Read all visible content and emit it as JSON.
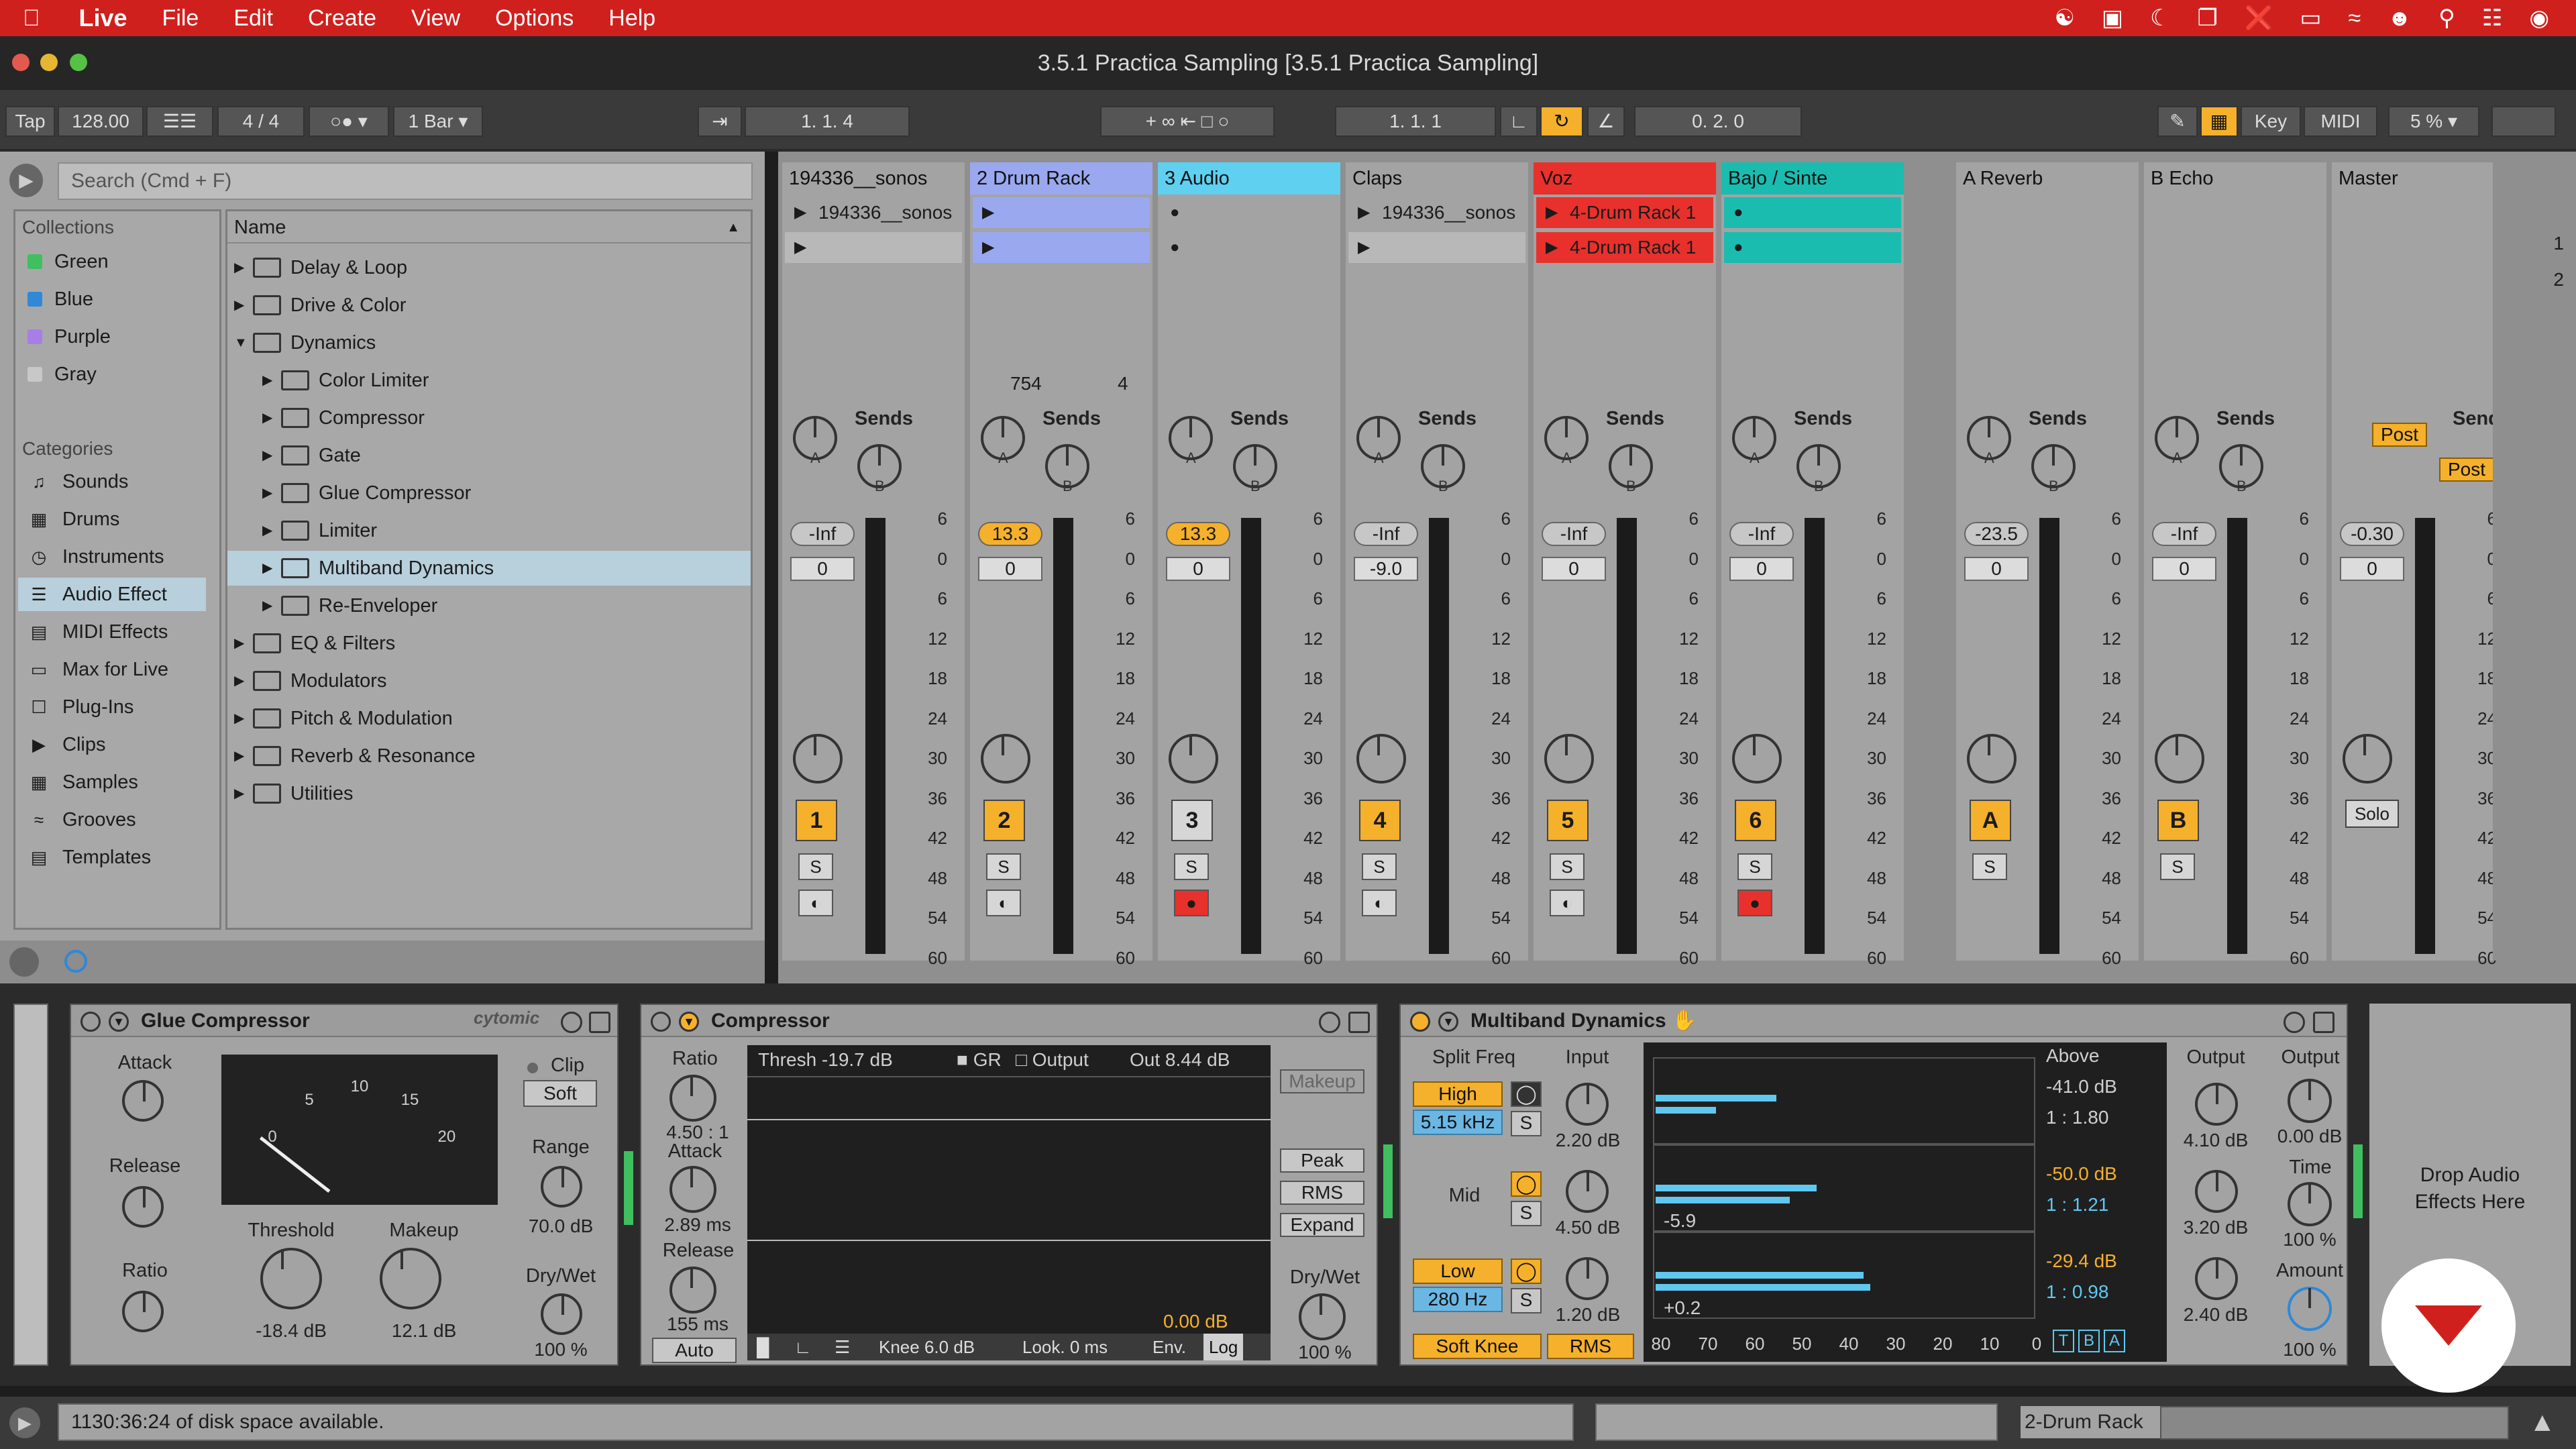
{
  "menubar": {
    "app": "Live",
    "items": [
      "File",
      "Edit",
      "Create",
      "View",
      "Options",
      "Help"
    ]
  },
  "window": {
    "title": "3.5.1 Practica Sampling  [3.5.1 Practica Sampling]"
  },
  "transport": {
    "tap": "Tap",
    "tempo": "128.00",
    "signature": "4 / 4",
    "quantize": "1 Bar",
    "position": "1.   1.   4",
    "loop_start": "1.   1.   1",
    "loop_length": "0.   2.   0",
    "key": "Key",
    "midi": "MIDI",
    "cpu": "5 %"
  },
  "browser": {
    "search_placeholder": "Search (Cmd + F)",
    "collections_title": "Collections",
    "collections": [
      {
        "name": "Green",
        "color": "#3fbf5f"
      },
      {
        "name": "Blue",
        "color": "#2f88d8"
      },
      {
        "name": "Purple",
        "color": "#a77ee6"
      },
      {
        "name": "Gray",
        "color": "#c8c8c8"
      }
    ],
    "categories_title": "Categories",
    "categories": [
      "Sounds",
      "Drums",
      "Instruments",
      "Audio Effect",
      "MIDI Effects",
      "Max for Live",
      "Plug-Ins",
      "Clips",
      "Samples",
      "Grooves",
      "Templates"
    ],
    "selected_category": "Audio Effect",
    "name_header": "Name",
    "items": [
      {
        "name": "Delay & Loop",
        "indent": 0,
        "open": false
      },
      {
        "name": "Drive & Color",
        "indent": 0,
        "open": false
      },
      {
        "name": "Dynamics",
        "indent": 0,
        "open": true
      },
      {
        "name": "Color Limiter",
        "indent": 1,
        "open": false
      },
      {
        "name": "Compressor",
        "indent": 1,
        "open": false
      },
      {
        "name": "Gate",
        "indent": 1,
        "open": false
      },
      {
        "name": "Glue Compressor",
        "indent": 1,
        "open": false
      },
      {
        "name": "Limiter",
        "indent": 1,
        "open": false
      },
      {
        "name": "Multiband Dynamics",
        "indent": 1,
        "open": false,
        "selected": true
      },
      {
        "name": "Re-Enveloper",
        "indent": 1,
        "open": false
      },
      {
        "name": "EQ & Filters",
        "indent": 0,
        "open": false
      },
      {
        "name": "Modulators",
        "indent": 0,
        "open": false
      },
      {
        "name": "Pitch & Modulation",
        "indent": 0,
        "open": false
      },
      {
        "name": "Reverb & Resonance",
        "indent": 0,
        "open": false
      },
      {
        "name": "Utilities",
        "indent": 0,
        "open": false
      }
    ]
  },
  "tracks": [
    {
      "name": "194336__sonos",
      "color": "#a3a3a3",
      "clip1": "194336__sonos",
      "clipcolor": "#a3a3a3",
      "vol": "-Inf",
      "volOn": false,
      "pan": "0",
      "num": "1",
      "numOn": true,
      "rec": false
    },
    {
      "name": "2 Drum Rack",
      "color": "#9aa8f0",
      "clip1": "",
      "clipcolor": "#9aa8f0",
      "vol": "13.3",
      "volOn": true,
      "pan": "0",
      "num": "2",
      "numOn": true,
      "rec": false,
      "extra": "754",
      "extra2": "4"
    },
    {
      "name": "3 Audio",
      "color": "#5fd0f0",
      "clip1": "",
      "clipcolor": "#a3a3a3",
      "vol": "13.3",
      "volOn": true,
      "pan": "0",
      "num": "3",
      "numOn": false,
      "rec": true
    },
    {
      "name": "Claps",
      "color": "#a3a3a3",
      "clip1": "194336__sonos",
      "clipcolor": "#a3a3a3",
      "vol": "-Inf",
      "volOn": false,
      "pan": "-9.0",
      "num": "4",
      "numOn": true,
      "rec": false
    },
    {
      "name": "Voz",
      "color": "#e8312c",
      "clip1": "4-Drum Rack 1",
      "clip2": "4-Drum Rack 1",
      "clipcolor": "#e8312c",
      "vol": "-Inf",
      "volOn": false,
      "pan": "0",
      "num": "5",
      "numOn": true,
      "rec": false
    },
    {
      "name": "Bajo / Sinte",
      "color": "#1bbcb0",
      "clip1": "",
      "clipcolor": "#1bbcb0",
      "vol": "-Inf",
      "volOn": false,
      "pan": "0",
      "num": "6",
      "numOn": true,
      "rec": true
    }
  ],
  "returns": [
    {
      "name": "A Reverb",
      "vol": "-23.5",
      "pan": "0",
      "num": "A"
    },
    {
      "name": "B Echo",
      "vol": "-Inf",
      "pan": "0",
      "num": "B"
    },
    {
      "name": "Master",
      "vol": "-0.30",
      "pan": "0",
      "num": "Solo",
      "post": "Post"
    }
  ],
  "mixer": {
    "sends": "Sends",
    "scale": [
      "6",
      "0",
      "6",
      "12",
      "18",
      "24",
      "30",
      "36",
      "42",
      "48",
      "54",
      "60"
    ],
    "solo": "S",
    "scene1": "1",
    "scene2": "2"
  },
  "glue": {
    "title": "Glue Compressor",
    "brand": "cytomic",
    "attack": "Attack",
    "release": "Release",
    "ratio": "Ratio",
    "clip": "Clip",
    "soft": "Soft",
    "range": "Range",
    "range_val": "70.0 dB",
    "threshold": "Threshold",
    "threshold_val": "-18.4 dB",
    "makeup": "Makeup",
    "makeup_val": "12.1 dB",
    "drywet": "Dry/Wet",
    "drywet_val": "100 %",
    "meter_ticks": [
      "0",
      "5",
      "10",
      "15",
      "20"
    ]
  },
  "comp": {
    "title": "Compressor",
    "ratio": "Ratio",
    "ratio_val": "4.50 : 1",
    "attack": "Attack",
    "attack_val": "2.89 ms",
    "release": "Release",
    "release_val": "155 ms",
    "auto": "Auto",
    "thresh": "Thresh -19.7 dB",
    "gr": "GR",
    "output": "Output",
    "out": "Out 8.44 dB",
    "out_db": "0.00 dB",
    "makeup": "Makeup",
    "peak": "Peak",
    "rms": "RMS",
    "expand": "Expand",
    "knee": "Knee 6.0 dB",
    "look": "Look. 0 ms",
    "env": "Env.",
    "log": "Log",
    "drywet": "Dry/Wet",
    "drywet_val": "100 %"
  },
  "mbd": {
    "title": "Multiband Dynamics",
    "split": "Split Freq",
    "input": "Input",
    "high": "High",
    "high_freq": "5.15 kHz",
    "mid": "Mid",
    "low": "Low",
    "low_freq": "280 Hz",
    "in_h": "2.20 dB",
    "in_m": "4.50 dB",
    "in_l": "1.20 dB",
    "above": "Above",
    "a_h": "-41.0 dB",
    "r_h": "1 : 1.80",
    "a_m": "-50.0 dB",
    "r_m": "1 : 1.21",
    "a_l": "-29.4 dB",
    "r_l": "1 : 0.98",
    "mval": "-5.9",
    "lval": "+0.2",
    "output": "Output",
    "o_h": "4.10 dB",
    "o_m": "3.20 dB",
    "o_l": "2.40 dB",
    "output2": "Output",
    "o2": "0.00 dB",
    "time": "Time",
    "time_val": "100 %",
    "amount": "Amount",
    "amount_val": "100 %",
    "soft_knee": "Soft Knee",
    "rms": "RMS",
    "axis": [
      "80",
      "70",
      "60",
      "50",
      "40",
      "30",
      "20",
      "10",
      "0"
    ],
    "tba": [
      "T",
      "B",
      "A"
    ]
  },
  "drop": "Drop Audio Effects Here",
  "status": {
    "text": "1130:36:24 of disk space available.",
    "track": "2-Drum Rack"
  }
}
